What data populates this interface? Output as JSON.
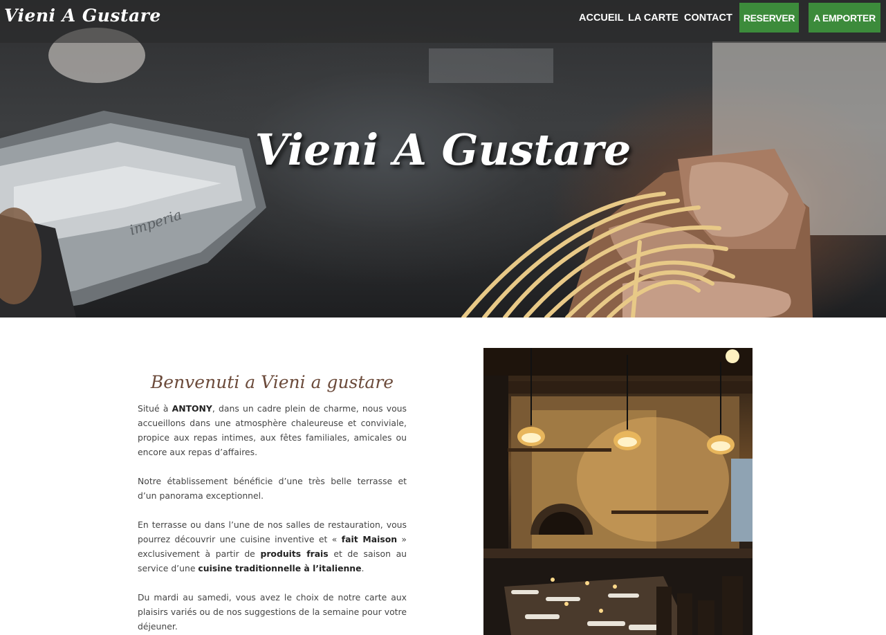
{
  "nav": {
    "logo": "Vieni A Gustare",
    "links": [
      "ACCUEIL",
      "LA CARTE",
      "CONTACT"
    ],
    "reserve_label": "RESERVER",
    "takeaway_label": "A EMPORTER"
  },
  "hero": {
    "title": "Vieni A Gustare"
  },
  "welcome": {
    "heading": "Benvenuti a Vieni a gustare",
    "p1": {
      "t1": "Situé à ",
      "b1": "ANTONY",
      "t2": ", dans un cadre plein de charme, nous vous accueillons dans une atmosphère chaleureuse et conviviale, propice aux repas intimes, aux fêtes familiales, amicales ou encore aux repas d’affaires."
    },
    "p2": "Notre établissement bénéficie d’une très belle terrasse et d’un panorama exceptionnel.",
    "p3": {
      "t1": "En terrasse ou dans l’une de nos salles de restauration, vous pourrez découvrir une cuisine inventive et « ",
      "b1": "fait Maison",
      "t2": " » exclusivement à partir de ",
      "b2": "produits frais",
      "t3": " et de saison au service d’une ",
      "b3": "cuisine traditionnelle à l’italienne",
      "t4": "."
    },
    "p4": "Du mardi au samedi, vous avez le choix de notre carte aux plaisirs variés ou de nos suggestions de la semaine pour votre déjeuner."
  },
  "colors": {
    "accent_green": "#3c8b3b",
    "heading_brown": "#6b4a3a"
  }
}
